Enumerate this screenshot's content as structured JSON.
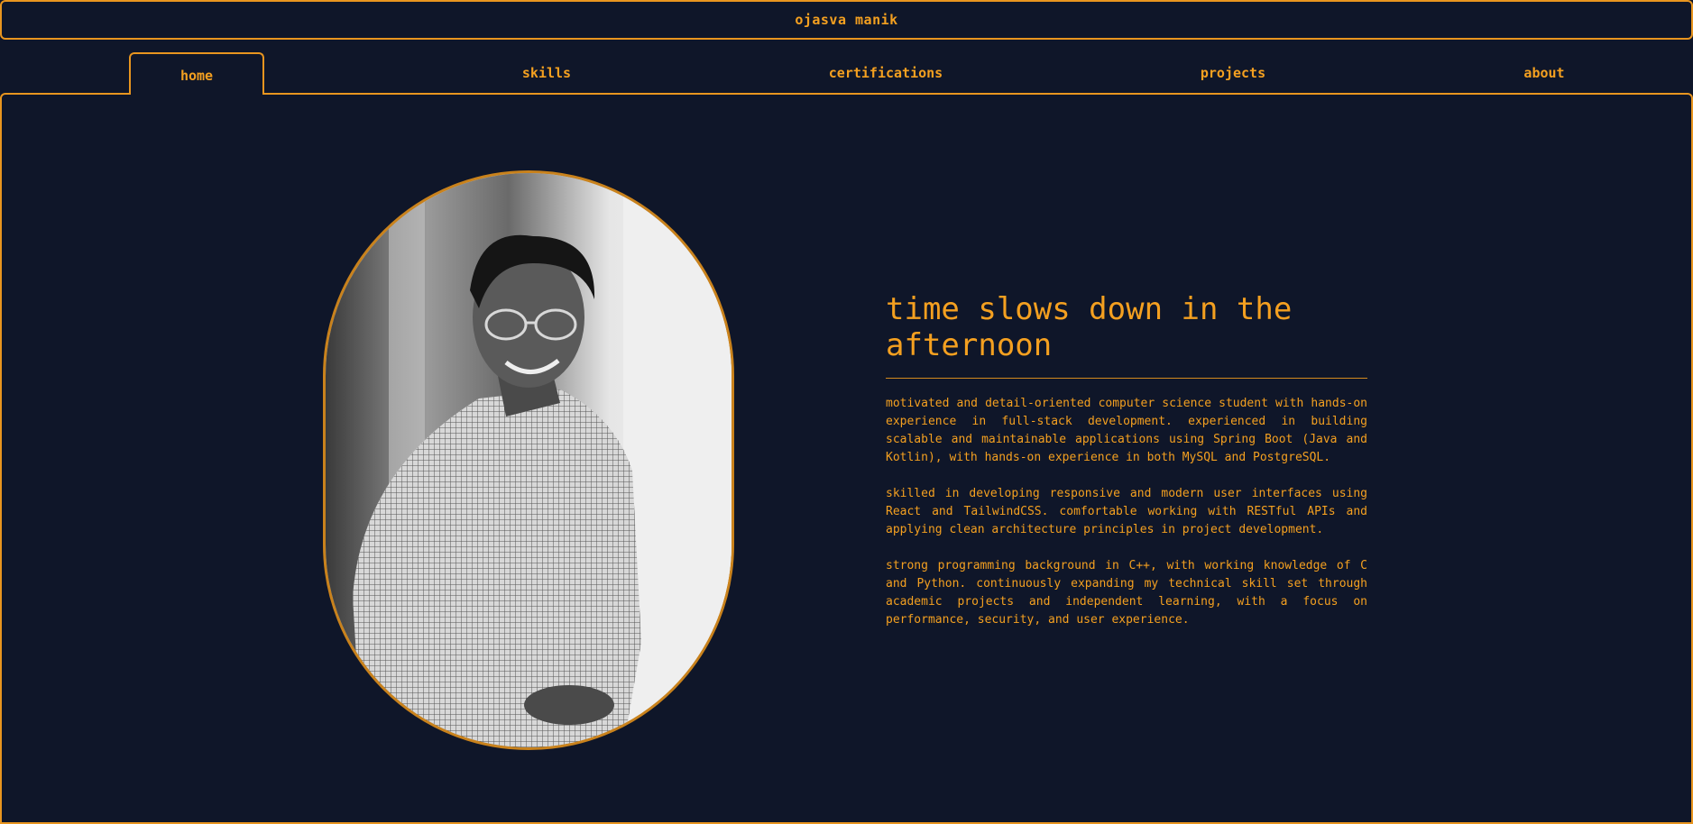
{
  "header": {
    "title": "ojasva manik"
  },
  "nav": {
    "tabs": [
      {
        "label": "home",
        "active": true
      },
      {
        "label": "skills",
        "active": false
      },
      {
        "label": "certifications",
        "active": false
      },
      {
        "label": "projects",
        "active": false
      },
      {
        "label": "about",
        "active": false
      }
    ]
  },
  "main": {
    "headline": "time slows down in the afternoon",
    "paragraphs": [
      "motivated and detail-oriented computer science student with hands-on experience in full-stack development. experienced in building scalable and maintainable applications using Spring Boot (Java and Kotlin), with hands-on experience in both MySQL and PostgreSQL.",
      "skilled in developing responsive and modern user interfaces using React and TailwindCSS. comfortable working with RESTful APIs and applying clean architecture principles in project development.",
      "strong programming background in C++, with working knowledge of C and Python. continuously expanding my technical skill set through academic projects and independent learning, with a focus on performance, security, and user experience."
    ]
  },
  "colors": {
    "background": "#0f1629",
    "accent": "#f4a020",
    "border": "#e8951f"
  }
}
